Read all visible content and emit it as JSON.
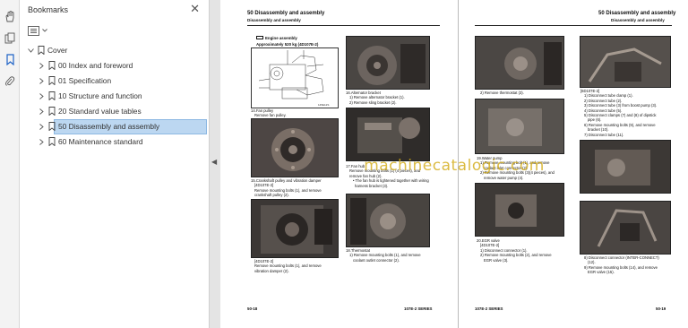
{
  "sidebar_rail": {
    "icons": [
      "hand-icon",
      "pages-icon",
      "bookmark-icon",
      "attachment-icon"
    ]
  },
  "bookmarks": {
    "title": "Bookmarks",
    "items": [
      {
        "label": "Cover",
        "level": 0,
        "expanded": true,
        "selected": false
      },
      {
        "label": "00 Index and foreword",
        "level": 1,
        "expanded": false,
        "selected": false
      },
      {
        "label": "01 Specification",
        "level": 1,
        "expanded": false,
        "selected": false
      },
      {
        "label": "10 Structure and function",
        "level": 1,
        "expanded": false,
        "selected": false
      },
      {
        "label": "20 Standard value tables",
        "level": 1,
        "expanded": false,
        "selected": false
      },
      {
        "label": "50 Disassembly and assembly",
        "level": 1,
        "expanded": false,
        "selected": true
      },
      {
        "label": "60 Maintenance standard",
        "level": 1,
        "expanded": false,
        "selected": false
      }
    ]
  },
  "left_page": {
    "header": "50 Disassembly and assembly",
    "subheader": "Disassembly and assembly",
    "diagram_label": "Engine assembly",
    "diagram_weight": "Approximately 520 kg (4D107E-2)",
    "captions": {
      "fan_pulley": [
        "14.Fan pulley",
        "Remove fan pulley."
      ],
      "crank_pulley": [
        "15.Crankshaft pulley and vibration damper",
        "[4D107E-2]",
        "Remove mounting bolts (1), and remove",
        "crankshaft pulley (2)."
      ],
      "damper": [
        "[4D107E-2]",
        "Remove mounting bolts (1), and remove",
        "vibration damper (2)."
      ],
      "alternator": [
        "16.Alternator bracket",
        "1) Remove alternator bracket (1).",
        "2) Remove sling bracket (2)."
      ],
      "fan_hub": [
        "17.Fan hub",
        "Remove mounting bolts (1) (4 pieces), and",
        "remove fan hub (2).",
        "• The fan hub is tightened together with wiring",
        "harness bracket (3)."
      ],
      "thermostat": [
        "18.Thermostat",
        "1) Remove mounting bolts (1), and remove",
        "coolant outlet connector (2)."
      ]
    },
    "footer_left": "50-18",
    "footer_right": "107E-2 SERIES"
  },
  "right_page": {
    "header": "50 Disassembly and assembly",
    "subheader": "Disassembly and assembly",
    "captions": {
      "thermostat2": [
        "2) Remove thermostat (3)."
      ],
      "water_pump": [
        "19.Water pump",
        "1) Remove mounting bolt (1), and remove",
        "coolant inlet connector (2).",
        "2) Remove mounting bolts (3)(4 pieces), and",
        "remove water pump (4)."
      ],
      "egr": [
        "20.EGR valve",
        "[4D107E-2]",
        "1) Disconnect connector (1).",
        "2) Remove mounting bolts (2), and remove",
        "EGR valve (3)."
      ],
      "tubes": [
        "[6D107E-2]",
        "1) Disconnect tube clamp (1).",
        "2) Disconnect tube (2).",
        "3) Disconnect tube (3) from boost pump (3).",
        "4) Disconnect tube (5).",
        "5) Disconnect clamps (7) and (8) of dipstick",
        "pipe (6).",
        "6) Remove mounting bolts (9), and remove",
        "bracket (10).",
        "7) Disconnect tube (11)."
      ],
      "connector": [
        "8) Disconnect connector (INTER-CONNECT)",
        "(12).",
        "9) Remove mounting bolts (14), and remove",
        "EGR valve (15)."
      ]
    },
    "footer_left": "107E-2 SERIES",
    "footer_right": "50-19"
  },
  "watermark": "machinecatalogic.com",
  "colors": {
    "selection": "#bcd7f1",
    "doc_bg": "#9c9c9c",
    "watermark": "#d2aa14"
  }
}
